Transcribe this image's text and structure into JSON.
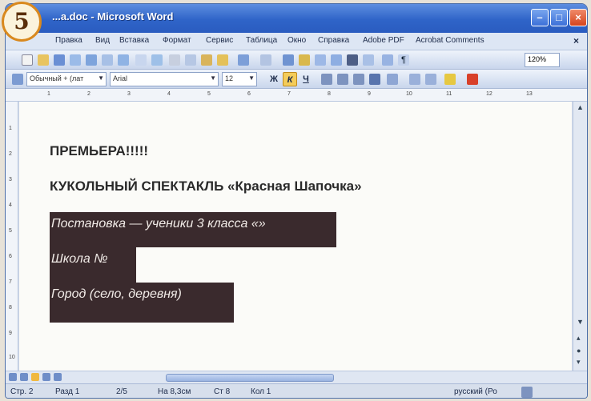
{
  "step_number": "5",
  "titlebar": {
    "title": "...a.doc - Microsoft Word"
  },
  "menubar": {
    "items": [
      "Правка",
      "Вид",
      "Вставка",
      "Формат",
      "Сервис",
      "Таблица",
      "Окно",
      "Справка",
      "Adobe PDF",
      "Acrobat Comments"
    ],
    "close": "×"
  },
  "toolbar_format": {
    "style": "Обычный + (лат",
    "font": "Arial",
    "size": "12",
    "bold": "Ж",
    "italic": "К",
    "underline": "Ч"
  },
  "toolbar_standard": {
    "zoom": "120%"
  },
  "ruler": {
    "numbers": [
      "1",
      "2",
      "3",
      "4",
      "5",
      "6",
      "7",
      "8",
      "9",
      "10",
      "11",
      "12",
      "13"
    ],
    "vnumbers": [
      "1",
      "2",
      "3",
      "4",
      "5",
      "6",
      "7",
      "8",
      "9",
      "10"
    ]
  },
  "document": {
    "line1": "ПРЕМЬЕРА!!!!!",
    "line2": "КУКОЛЬНЫЙ СПЕКТАКЛЬ «Красная Шапочка»",
    "line3": "Постановка — ученики 3 класса «»",
    "line4": "Школа №",
    "line5": "Город (село, деревня)",
    "highlight_color": "#3a2a2d"
  },
  "statusbar": {
    "page": "Стр. 2",
    "section": "Разд 1",
    "pages": "2/5",
    "at": "На 8,3см",
    "line": "Ст 8",
    "col": "Кол 1",
    "language": "русский (Ро"
  }
}
